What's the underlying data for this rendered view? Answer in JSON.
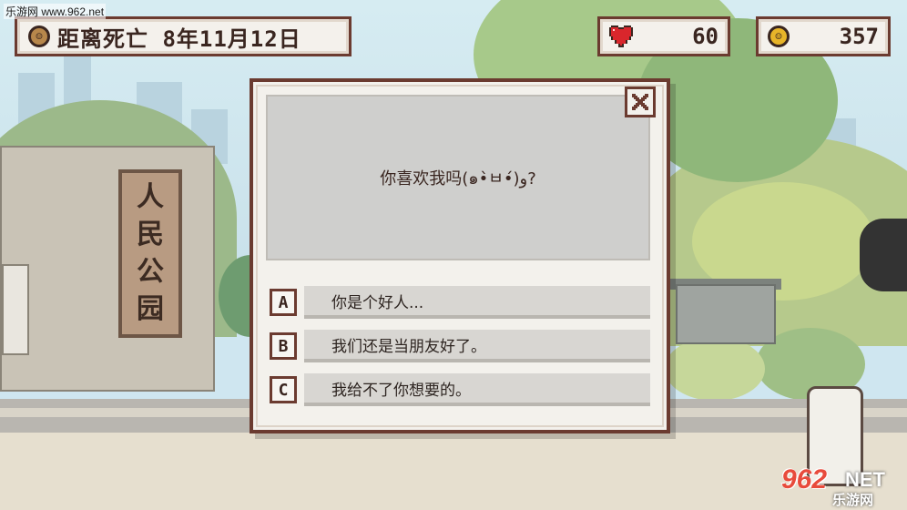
{
  "hud": {
    "countdown_label": "距离死亡 8年11月12日",
    "health": "60",
    "coins": "357"
  },
  "scene": {
    "sign_chars": [
      "人",
      "民",
      "公",
      "园"
    ]
  },
  "dialog": {
    "question": "你喜欢我吗(๑•̀ㅂ•́)و?",
    "options": [
      {
        "letter": "A",
        "text": "你是个好人..."
      },
      {
        "letter": "B",
        "text": "我们还是当朋友好了。"
      },
      {
        "letter": "C",
        "text": "我给不了你想要的。"
      }
    ]
  },
  "watermark": {
    "top_text": "乐游网 www.962.net",
    "logo_num": "962",
    "logo_net": "NET",
    "logo_cn": "乐游网"
  },
  "colors": {
    "frame": "#6b3b30",
    "panel": "#f3f1ec",
    "heart": "#d9262c",
    "coin": "#e7b429"
  },
  "icons": {
    "countdown": "brown-coin-face-icon",
    "health": "heart-icon",
    "coins": "gold-coin-icon",
    "close": "close-x-icon"
  }
}
